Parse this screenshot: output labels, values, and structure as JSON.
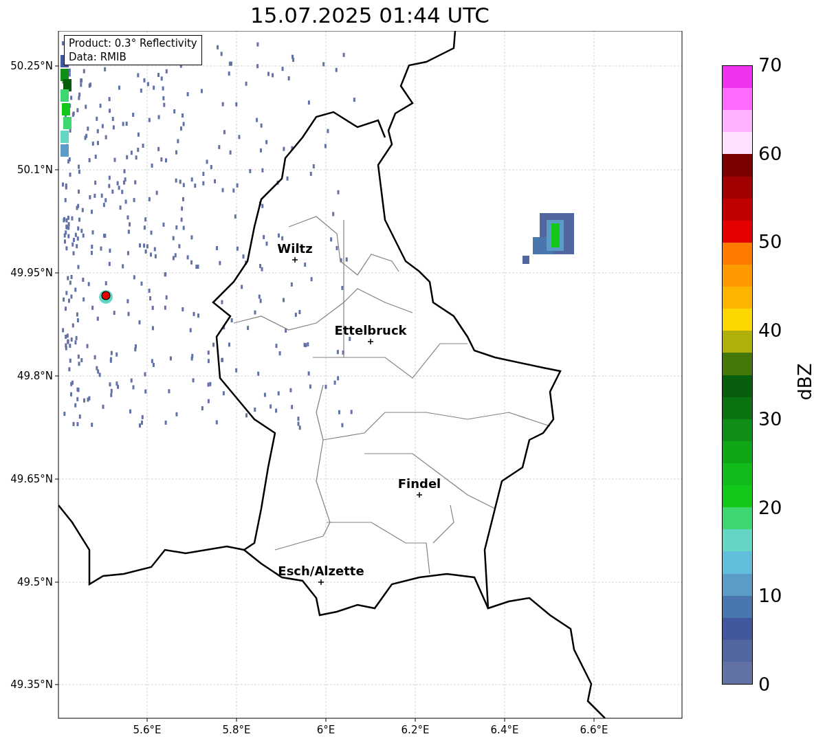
{
  "title": "15.07.2025 01:44 UTC",
  "map": {
    "info": [
      "Product: 0.3° Reflectivity",
      "Data: RMIB"
    ],
    "y_ticks": [
      "50.25°N",
      "50.1°N",
      "49.95°N",
      "49.8°N",
      "49.65°N",
      "49.5°N",
      "49.35°N"
    ],
    "x_ticks": [
      "5.6°E",
      "5.8°E",
      "6°E",
      "6.2°E",
      "6.4°E",
      "6.6°E"
    ],
    "cities": [
      {
        "name": "Wiltz"
      },
      {
        "name": "Ettelbruck"
      },
      {
        "name": "Findel"
      },
      {
        "name": "Esch/Alzette"
      }
    ]
  },
  "colorbar": {
    "label": "dBZ",
    "ticks": [
      "70",
      "60",
      "50",
      "40",
      "30",
      "20",
      "10",
      "0"
    ],
    "bins": [
      {
        "color": "#ee33ee"
      },
      {
        "color": "#ff6bff"
      },
      {
        "color": "#ffb3ff"
      },
      {
        "color": "#ffe0ff"
      },
      {
        "color": "#7a0000"
      },
      {
        "color": "#a00000"
      },
      {
        "color": "#c00000"
      },
      {
        "color": "#e50000"
      },
      {
        "color": "#ff7b00"
      },
      {
        "color": "#fe9a00"
      },
      {
        "color": "#fdb400"
      },
      {
        "color": "#ffd700"
      },
      {
        "color": "#afb10a"
      },
      {
        "color": "#45780a"
      },
      {
        "color": "#075e0c"
      },
      {
        "color": "#0b7212"
      },
      {
        "color": "#0e8e16"
      },
      {
        "color": "#0fa618"
      },
      {
        "color": "#10bb1a"
      },
      {
        "color": "#12c91a"
      },
      {
        "color": "#3dd670"
      },
      {
        "color": "#63d6c4"
      },
      {
        "color": "#63bedb"
      },
      {
        "color": "#5a9cc6"
      },
      {
        "color": "#4a76b0"
      },
      {
        "color": "#41589f"
      },
      {
        "color": "#52669f"
      },
      {
        "color": "#6272a5"
      }
    ]
  }
}
